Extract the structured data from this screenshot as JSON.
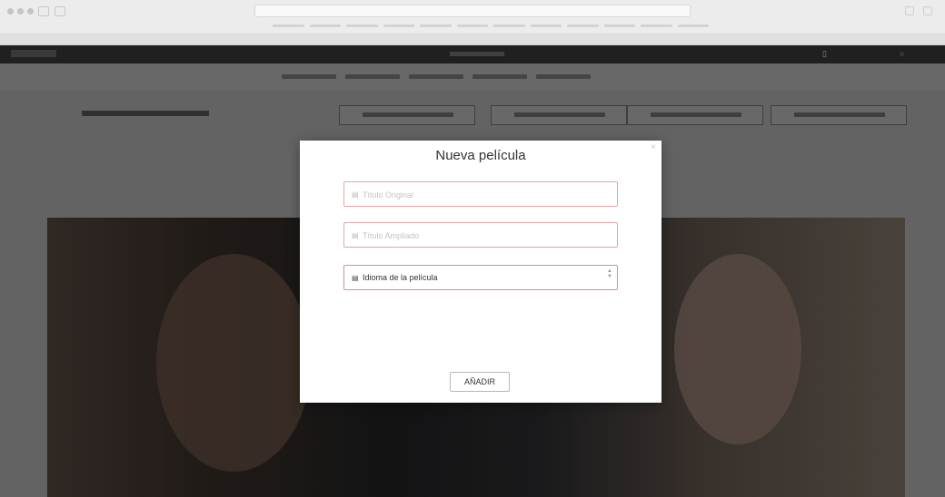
{
  "modal": {
    "title": "Nueva película",
    "close_label": "×",
    "fields": {
      "original_title_placeholder": "Título Original",
      "translated_title_placeholder": "Título Ampliado",
      "language_value": "Idioma de la película"
    },
    "submit_label": "AÑADIR"
  },
  "icons": {
    "film": "film-icon",
    "dropdown": "chevron-icon"
  },
  "colors": {
    "field_border": "#e2a6a6",
    "overlay": "rgba(0,0,0,0.55)",
    "header_bg": "#202020"
  }
}
